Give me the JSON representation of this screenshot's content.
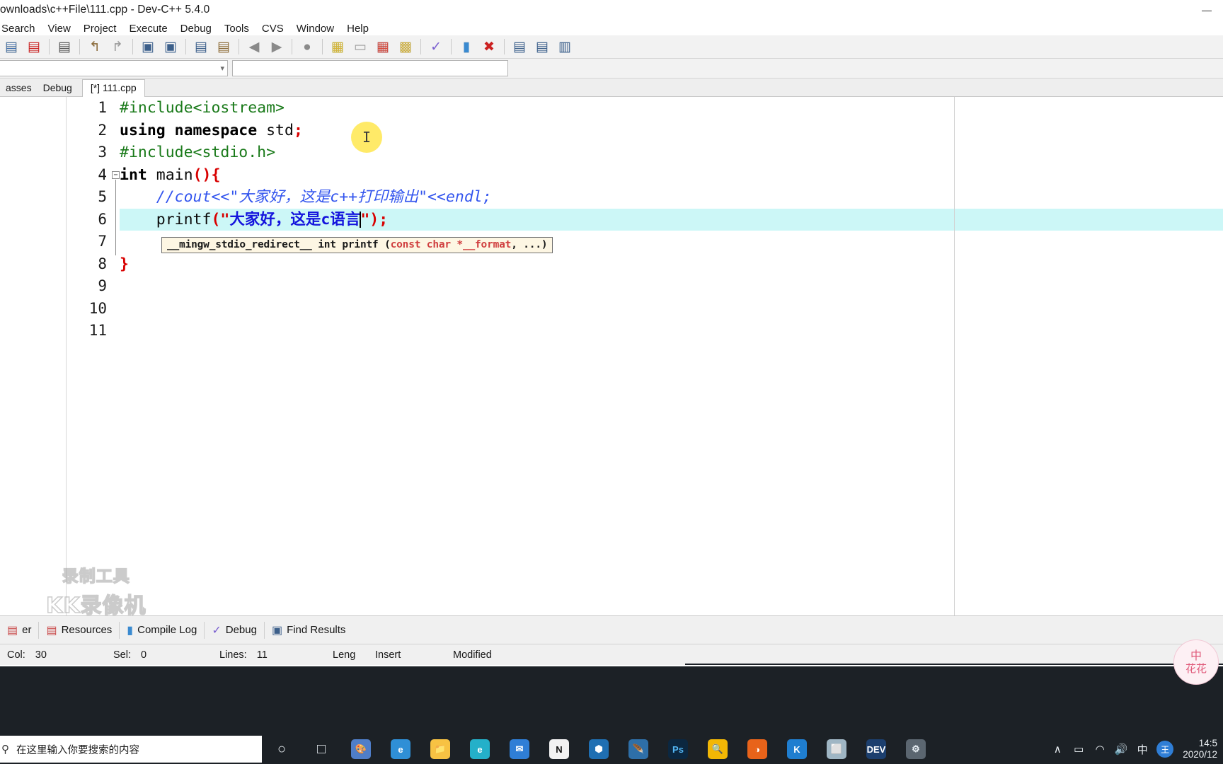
{
  "window": {
    "title": "ownloads\\c++File\\111.cpp - Dev-C++ 5.4.0",
    "minimize": "—",
    "maximize": "❐",
    "close": "✕"
  },
  "menu": {
    "items": [
      {
        "label": "Search"
      },
      {
        "label": "View"
      },
      {
        "label": "Project"
      },
      {
        "label": "Execute"
      },
      {
        "label": "Debug"
      },
      {
        "label": "Tools"
      },
      {
        "label": "CVS"
      },
      {
        "label": "Window"
      },
      {
        "label": "Help"
      }
    ]
  },
  "toolbar": {
    "icons": [
      {
        "name": "save-all-icon"
      },
      {
        "name": "close-file-icon"
      },
      {
        "sep": true
      },
      {
        "name": "print-icon"
      },
      {
        "sep": true
      },
      {
        "name": "undo-icon"
      },
      {
        "name": "redo-icon"
      },
      {
        "sep": true
      },
      {
        "name": "find-icon"
      },
      {
        "name": "find-next-icon"
      },
      {
        "sep": true
      },
      {
        "name": "goto-line-icon"
      },
      {
        "name": "goto-function-icon"
      },
      {
        "sep": true
      },
      {
        "name": "step-back-icon"
      },
      {
        "name": "step-forward-icon"
      },
      {
        "sep": true
      },
      {
        "name": "profile-icon"
      },
      {
        "sep": true
      },
      {
        "name": "compile-icon"
      },
      {
        "name": "run-icon"
      },
      {
        "name": "compile-run-icon"
      },
      {
        "name": "rebuild-all-icon"
      },
      {
        "sep": true
      },
      {
        "name": "syntax-check-icon"
      },
      {
        "sep": true
      },
      {
        "name": "profile-analysis-icon"
      },
      {
        "name": "delete-profile-icon"
      },
      {
        "sep": true
      },
      {
        "name": "debug-icon"
      },
      {
        "name": "toggle-panel-icon"
      },
      {
        "name": "toggle-sidebar-icon"
      }
    ]
  },
  "combos": {
    "left_value": "",
    "right_value": ""
  },
  "tabs": {
    "side": [
      {
        "label": "asses"
      },
      {
        "label": "Debug"
      }
    ],
    "file": {
      "label": "[*] 111.cpp"
    }
  },
  "editor": {
    "line_numbers": [
      "1",
      "2",
      "3",
      "4",
      "5",
      "6",
      "7",
      "8",
      "9",
      "10",
      "11"
    ],
    "highlight_line": 6,
    "fold_marker_line": 4,
    "lines": [
      {
        "n": 1,
        "tokens": [
          {
            "t": "#include<iostream>",
            "c": "prep"
          }
        ]
      },
      {
        "n": 2,
        "tokens": [
          {
            "t": "using namespace",
            "c": "kw"
          },
          {
            "t": " std",
            "c": "plain"
          },
          {
            "t": ";",
            "c": "red"
          }
        ]
      },
      {
        "n": 3,
        "tokens": [
          {
            "t": "#include<stdio.h>",
            "c": "prep"
          }
        ]
      },
      {
        "n": 4,
        "tokens": [
          {
            "t": "int",
            "c": "kw"
          },
          {
            "t": " main",
            "c": "plain"
          },
          {
            "t": "(){",
            "c": "red"
          }
        ]
      },
      {
        "n": 5,
        "tokens": [
          {
            "t": "    //cout<<\"大家好，这是c++打印输出\"<<endl;",
            "c": "cmt"
          }
        ]
      },
      {
        "n": 6,
        "tokens": [
          {
            "t": "    printf",
            "c": "plain"
          },
          {
            "t": "(",
            "c": "red"
          },
          {
            "t": "\"",
            "c": "red"
          },
          {
            "t": "大家好，这是c语言",
            "c": "str"
          },
          {
            "t": "CARET",
            "c": "caret"
          },
          {
            "t": "\"",
            "c": "red"
          },
          {
            "t": ");",
            "c": "red"
          }
        ]
      },
      {
        "n": 7,
        "tokens": []
      },
      {
        "n": 8,
        "tokens": [
          {
            "t": "}",
            "c": "red"
          }
        ]
      },
      {
        "n": 9,
        "tokens": []
      },
      {
        "n": 10,
        "tokens": []
      },
      {
        "n": 11,
        "tokens": []
      }
    ]
  },
  "tooltip": {
    "prefix": "__mingw_stdio_redirect__ int printf (",
    "args": "const char *__format",
    "suffix": ", ...)"
  },
  "cursor": {
    "icon": "text-ibeam-cursor",
    "glyph": "I"
  },
  "watermark": {
    "line1": "录制工具",
    "line2": "KK录像机"
  },
  "corner_logo": {
    "top": "中",
    "bottom": "花花"
  },
  "bottom_tabs": {
    "items": [
      {
        "label": "er",
        "icon": "compiler-icon"
      },
      {
        "label": "Resources",
        "icon": "resources-icon"
      },
      {
        "label": "Compile Log",
        "icon": "compile-log-icon"
      },
      {
        "label": "Debug",
        "icon": "debug-check-icon"
      },
      {
        "label": "Find Results",
        "icon": "find-results-icon"
      }
    ]
  },
  "statusbar": {
    "col_label": "Col:",
    "col_value": "30",
    "sel_label": "Sel:",
    "sel_value": "0",
    "lines_label": "Lines:",
    "lines_value": "11",
    "length_label": "Leng",
    "insert_mode": "Insert",
    "modified": "Modified"
  },
  "taskbar": {
    "search_placeholder": "在这里输入你要搜索的内容",
    "search_icon": "search-icon",
    "apps": [
      {
        "name": "cortana-icon",
        "glyph": "○",
        "color": "transparent",
        "text": "#e6ecf0"
      },
      {
        "name": "task-view-icon",
        "glyph": "□",
        "color": "transparent",
        "text": "#e6ecf0"
      },
      {
        "name": "paint-icon",
        "glyph": "🎨",
        "color": "#4f7ec9",
        "text": "#ffffff"
      },
      {
        "name": "edge-icon",
        "glyph": "e",
        "color": "#2f8fd6",
        "text": "#ffffff"
      },
      {
        "name": "file-explorer-icon",
        "glyph": "📁",
        "color": "#f7c243",
        "text": "#7a5a00"
      },
      {
        "name": "browser-icon",
        "glyph": "e",
        "color": "#24b0c9",
        "text": "#ffffff"
      },
      {
        "name": "mail-icon",
        "glyph": "✉",
        "color": "#2f7ed6",
        "text": "#ffffff"
      },
      {
        "name": "notion-icon",
        "glyph": "N",
        "color": "#f2f2f2",
        "text": "#111111"
      },
      {
        "name": "vscode-icon",
        "glyph": "⬢",
        "color": "#1f6fb2",
        "text": "#ffffff"
      },
      {
        "name": "wireshark-icon",
        "glyph": "🪶",
        "color": "#2e6fa8",
        "text": "#ffffff"
      },
      {
        "name": "photoshop-icon",
        "glyph": "Ps",
        "color": "#0b2740",
        "text": "#53b7f5"
      },
      {
        "name": "search-tool-icon",
        "glyph": "🔍",
        "color": "#f2b705",
        "text": "#3a2a00"
      },
      {
        "name": "orange-app-icon",
        "glyph": "◑",
        "color": "#e8631a",
        "text": "#ffffff"
      },
      {
        "name": "kugou-icon",
        "glyph": "K",
        "color": "#1f7ed0",
        "text": "#ffffff"
      },
      {
        "name": "window-app-icon",
        "glyph": "⬜",
        "color": "#9fb6c4",
        "text": "#1b2026"
      },
      {
        "name": "devcpp-icon",
        "glyph": "DEV",
        "color": "#1c3f6e",
        "text": "#ffffff"
      },
      {
        "name": "settings-icon",
        "glyph": "⚙",
        "color": "#5b6670",
        "text": "#e7eef3"
      }
    ],
    "tray": [
      {
        "name": "show-hidden-icons-chevron",
        "glyph": "∧"
      },
      {
        "name": "battery-icon",
        "glyph": "▭"
      },
      {
        "name": "wifi-icon",
        "glyph": "◠"
      },
      {
        "name": "volume-icon",
        "glyph": "🔊"
      },
      {
        "name": "ime-language-icon",
        "glyph": "中"
      },
      {
        "name": "security-shield-icon",
        "glyph": "王"
      }
    ],
    "clock_time": "14:5",
    "clock_date": "2020/12"
  }
}
